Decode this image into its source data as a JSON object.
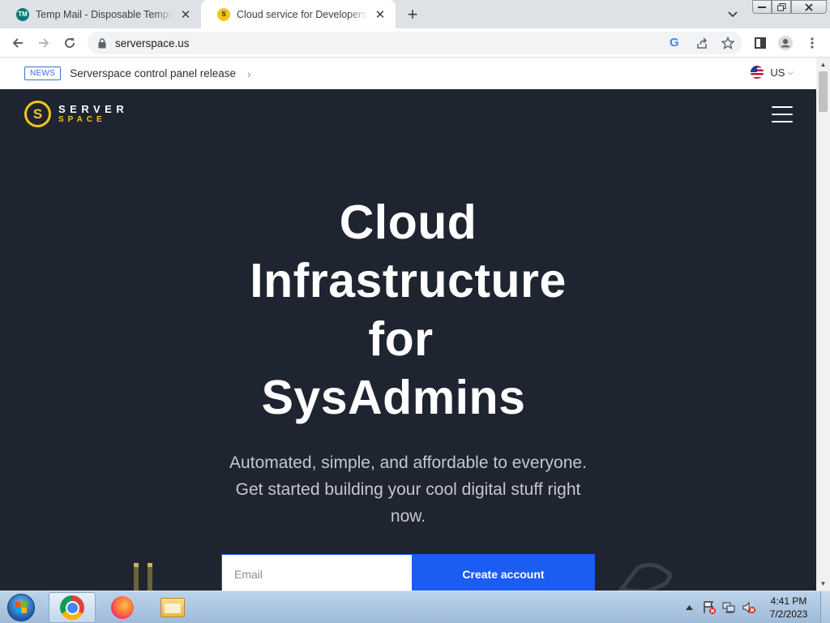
{
  "browser": {
    "tabs": [
      {
        "title": "Temp Mail - Disposable Temporary Email",
        "active": false,
        "favicon": "tempmail-icon"
      },
      {
        "title": "Cloud service for Developers in the US",
        "active": true,
        "favicon": "serverspace-icon"
      }
    ],
    "new_tab_label": "+",
    "url": "serverspace.us"
  },
  "page": {
    "news": {
      "badge": "NEWS",
      "text": "Serverspace control panel release",
      "chevron": "›"
    },
    "locale": {
      "label": "US",
      "caret": "⌵"
    },
    "logo": {
      "line1": "SERVER",
      "line2": "SPACE",
      "mark": "S"
    },
    "headline": [
      "Cloud",
      "Infrastructure",
      "for",
      "SysAdmins"
    ],
    "subtitle": "Automated, simple, and affordable to everyone. Get started building your cool digital stuff right now.",
    "signup": {
      "email_placeholder": "Email",
      "button_label": "Create account"
    },
    "colors": {
      "background": "#1f2431",
      "accent": "#1b5cf2",
      "brand_yellow": "#f5c518"
    }
  },
  "taskbar": {
    "clock_time": "4:41 PM",
    "clock_date": "7/2/2023",
    "tray_icons": [
      "show-hidden-icons-icon",
      "action-center-icon",
      "network-icon",
      "volume-muted-icon"
    ]
  }
}
